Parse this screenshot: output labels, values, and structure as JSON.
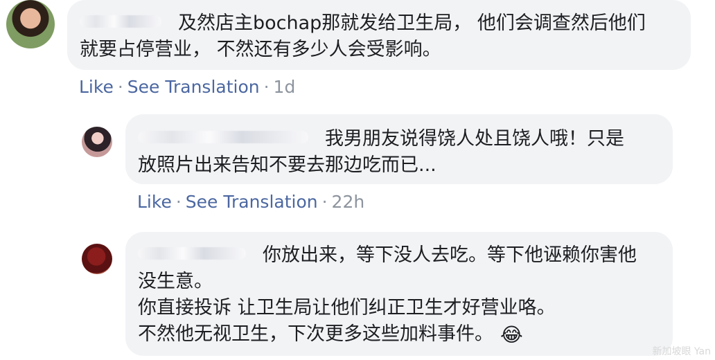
{
  "comments": [
    {
      "lines": [
        "及然店主bochap那就发给卫生局， 他们会调查然后他们",
        "就要占停营业， 不然还有多少人会受影响。"
      ],
      "actions": {
        "like": "Like",
        "separator": "·",
        "see_translation": "See Translation",
        "time": "1d"
      }
    },
    {
      "lines": [
        "我男朋友说得饶人处且饶人哦！只是",
        "放照片出来告知不要去那边吃而已..."
      ],
      "actions": {
        "like": "Like",
        "separator": "·",
        "see_translation": "See Translation",
        "time": "22h"
      }
    },
    {
      "lines": [
        "你放出来，等下没人去吃。等下他诬赖你害他",
        "没生意。",
        "你直接投诉 让卫生局让他们纠正卫生才好营业咯。",
        "不然他无视卫生，下次更多这些加料事件。"
      ],
      "emoji": "😂"
    }
  ],
  "watermark": "新加坡眼 Yan"
}
